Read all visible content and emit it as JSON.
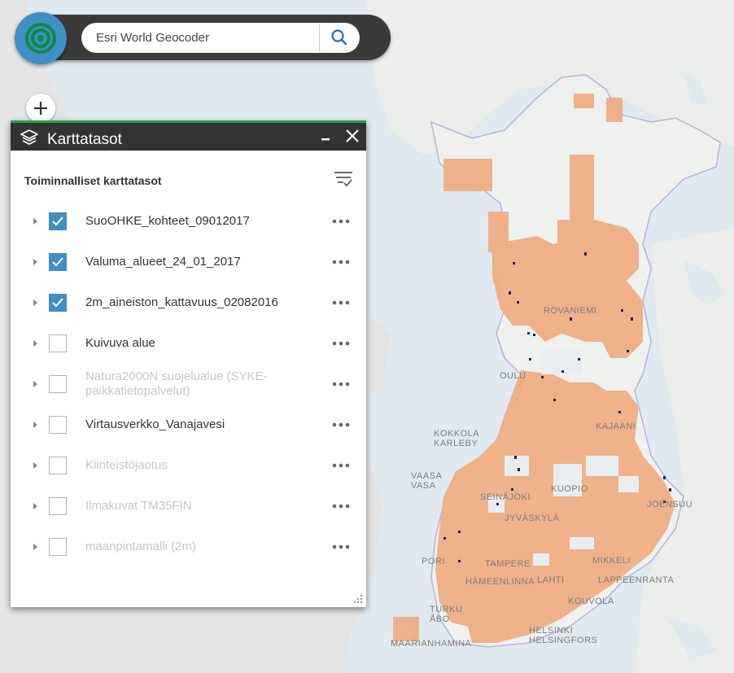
{
  "search": {
    "placeholder": "Esri World Geocoder"
  },
  "layer_panel": {
    "title": "Karttatasot",
    "section_title": "Toiminnalliset karttatasot",
    "layers": [
      {
        "label": "SuoOHKE_kohteet_09012017",
        "checked": true,
        "enabled": true
      },
      {
        "label": "Valuma_alueet_24_01_2017",
        "checked": true,
        "enabled": true
      },
      {
        "label": "2m_aineiston_kattavuus_02082016",
        "checked": true,
        "enabled": true
      },
      {
        "label": "Kuivuva alue",
        "checked": false,
        "enabled": true
      },
      {
        "label": "Natura2000N suojelualue (SYKE-paikkatietopalvelut)",
        "checked": false,
        "enabled": false
      },
      {
        "label": "Virtausverkko_Vanajavesi",
        "checked": false,
        "enabled": true
      },
      {
        "label": "Kiinteistöjaotus",
        "checked": false,
        "enabled": false
      },
      {
        "label": "Ilmakuvat TM35FIN",
        "checked": false,
        "enabled": false
      },
      {
        "label": "maanpintamalli (2m)",
        "checked": false,
        "enabled": false
      }
    ]
  },
  "map": {
    "labels": {
      "rovaniemi": "ROVANIEMI",
      "oulu": "OULU",
      "kajaani": "KAJAANI",
      "kokkola": "KOKKOLA",
      "karleby": "KARLEBY",
      "vaasa": "VAASA",
      "vasa": "VASA",
      "seinajoki": "SEINÄJOKI",
      "kuopio": "KUOPIO",
      "joensuu": "JOENSUU",
      "jyvaskyla": "JYVÄSKYLÄ",
      "pori": "PORI",
      "tampere": "TAMPERE",
      "mikkeli": "MIKKELI",
      "hameenlinna": "HÄMEENLINNA",
      "lahti": "LAHTI",
      "lappeenranta": "LAPPEENRANTA",
      "kouvola": "KOUVOLA",
      "turku": "TURKU",
      "abo": "ÅBO",
      "helsinki": "HELSINKI",
      "helsingfors": "HELSINGFORS",
      "maarianhamina": "MAARIANHAMINA"
    }
  },
  "colors": {
    "header_bg": "#3a3a3a",
    "accent_blue": "#3e8fc5",
    "panel_header_bg": "#333333",
    "panel_header_border": "#24a348",
    "coverage_fill": "#eeae85",
    "sea": "#dfe9ef",
    "land": "#eef1ee",
    "site_marker": "#1b2563"
  }
}
